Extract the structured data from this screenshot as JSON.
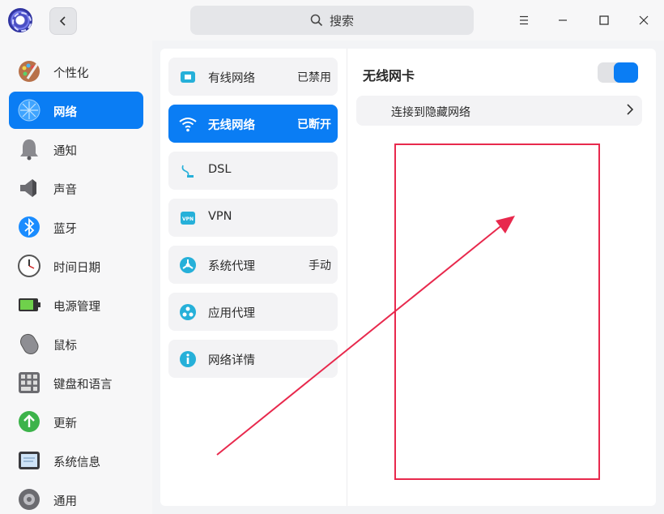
{
  "search": {
    "label": "搜索"
  },
  "sidebar": {
    "items": [
      {
        "label": "个性化",
        "icon": "palette-icon"
      },
      {
        "label": "网络",
        "icon": "network-icon"
      },
      {
        "label": "通知",
        "icon": "bell-icon"
      },
      {
        "label": "声音",
        "icon": "speaker-icon"
      },
      {
        "label": "蓝牙",
        "icon": "bluetooth-icon"
      },
      {
        "label": "时间日期",
        "icon": "clock-icon"
      },
      {
        "label": "电源管理",
        "icon": "battery-icon"
      },
      {
        "label": "鼠标",
        "icon": "mouse-icon"
      },
      {
        "label": "键盘和语言",
        "icon": "keyboard-icon"
      },
      {
        "label": "更新",
        "icon": "update-icon"
      },
      {
        "label": "系统信息",
        "icon": "system-info-icon"
      },
      {
        "label": "通用",
        "icon": "general-icon"
      }
    ]
  },
  "network": {
    "items": [
      {
        "label": "有线网络",
        "status": "已禁用",
        "icon": "wired-network-icon"
      },
      {
        "label": "无线网络",
        "status": "已断开",
        "icon": "wifi-icon"
      },
      {
        "label": "DSL",
        "status": "",
        "icon": "dsl-icon"
      },
      {
        "label": "VPN",
        "status": "",
        "icon": "vpn-icon"
      },
      {
        "label": "系统代理",
        "status": "手动",
        "icon": "system-proxy-icon"
      },
      {
        "label": "应用代理",
        "status": "",
        "icon": "app-proxy-icon"
      },
      {
        "label": "网络详情",
        "status": "",
        "icon": "info-icon"
      }
    ]
  },
  "wireless": {
    "title": "无线网卡",
    "toggle_on": true,
    "hidden_network_label": "连接到隐藏网络"
  },
  "colors": {
    "accent": "#0a7df4",
    "annotation": "#e8294d"
  }
}
